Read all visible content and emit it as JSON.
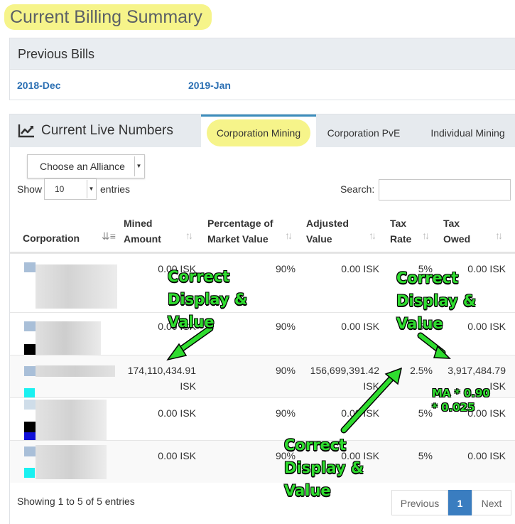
{
  "page": {
    "title": "Current Billing Summary"
  },
  "previous_bills": {
    "heading": "Previous Bills",
    "links": [
      "2018-Dec",
      "2019-Jan"
    ]
  },
  "live": {
    "title": "Current Live Numbers",
    "icon": "line-chart-icon",
    "tabs": [
      "Corporation Mining",
      "Corporation PvE",
      "Individual Mining"
    ],
    "active_tab": "Corporation Mining",
    "alliance_select": "Choose an Alliance",
    "show_label": "Show",
    "show_value": "10",
    "entries_label": "entries",
    "search_label": "Search:",
    "search_value": ""
  },
  "table": {
    "headers": {
      "corporation": "Corporation",
      "mined_1": "Mined",
      "mined_2": "Amount",
      "pct_1": "Percentage of",
      "pct_2": "Market Value",
      "adj_1": "Adjusted",
      "adj_2": "Value",
      "rate_1": "Tax",
      "rate_2": "Rate",
      "owed_1": "Tax",
      "owed_2": "Owed"
    },
    "rows": [
      {
        "mined_1": "0.00 ISK",
        "mined_2": "",
        "pct": "90%",
        "adj_1": "0.00 ISK",
        "adj_2": "",
        "rate": "5%",
        "owed_1": "0.00 ISK",
        "owed_2": ""
      },
      {
        "mined_1": "0.00 ISK",
        "mined_2": "",
        "pct": "90%",
        "adj_1": "0.00 ISK",
        "adj_2": "",
        "rate": "5%",
        "owed_1": "0.00 ISK",
        "owed_2": ""
      },
      {
        "mined_1": "174,110,434.91",
        "mined_2": "ISK",
        "pct": "90%",
        "adj_1": "156,699,391.42",
        "adj_2": "ISK",
        "rate": "2.5%",
        "owed_1": "3,917,484.79",
        "owed_2": "ISK"
      },
      {
        "mined_1": "0.00 ISK",
        "mined_2": "",
        "pct": "90%",
        "adj_1": "0.00 ISK",
        "adj_2": "",
        "rate": "5%",
        "owed_1": "0.00 ISK",
        "owed_2": ""
      },
      {
        "mined_1": "0.00 ISK",
        "mined_2": "",
        "pct": "90%",
        "adj_1": "0.00 ISK",
        "adj_2": "",
        "rate": "5%",
        "owed_1": "0.00 ISK",
        "owed_2": ""
      }
    ]
  },
  "footer": {
    "showing": "Showing 1 to 5 of 5 entries",
    "previous": "Previous",
    "page": "1",
    "next": "Next"
  },
  "annotations": {
    "note_1": "Correct",
    "note_2": "Display &",
    "note_3": "Value",
    "formula_1": "MA * 0.90",
    "formula_2": "* 0.025",
    "color": "#2fdc2f",
    "highlight_color": "#f6f48a"
  }
}
